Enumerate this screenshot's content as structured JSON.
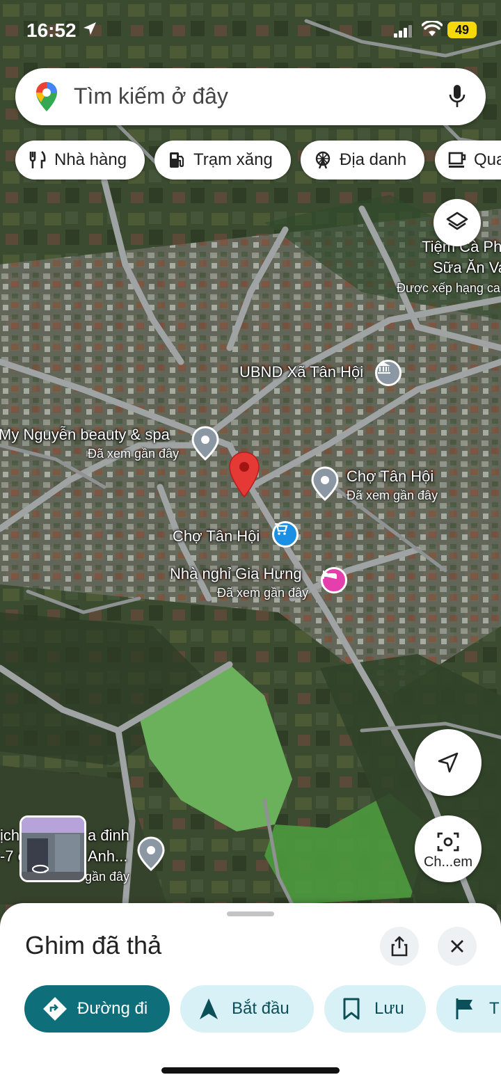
{
  "status": {
    "time": "16:52",
    "battery": "49"
  },
  "search": {
    "placeholder": "Tìm kiếm ở đây"
  },
  "chips": [
    {
      "label": "Nhà hàng",
      "icon": "fork-knife-icon"
    },
    {
      "label": "Trạm xăng",
      "icon": "gas-station-icon"
    },
    {
      "label": "Địa danh",
      "icon": "ferris-wheel-icon"
    },
    {
      "label": "Qua",
      "icon": "coffee-cup-icon"
    }
  ],
  "map_labels": {
    "cafe_line1": "Tiệm Cà Ph",
    "cafe_line2": "Sữa Ăn Va",
    "cafe_line3": "Được xếp hạng ca",
    "ubnd": "UBND Xã Tân Hội",
    "spa": "My Nguyễn beauty & spa",
    "spa_sub": "Đã xem gần đây",
    "cho1": "Chợ Tân Hội",
    "cho1_sub": "Đã xem gần đây",
    "cho2": "Chợ Tân Hội",
    "nha_nghi": "Nhà nghỉ Gia Hưng",
    "nha_nghi_sub": "Đã xem gần đây",
    "bottom_line1": "ịch",
    "bottom_line1b": "a đinh",
    "bottom_line2": "-7 c",
    "bottom_line2b": "Anh...",
    "bottom_sub": "gần đây",
    "lens_label": "Ch...em"
  },
  "sheet": {
    "title": "Ghim đã thả",
    "actions": [
      {
        "label": "Đường đi",
        "icon": "directions-icon"
      },
      {
        "label": "Bắt đầu",
        "icon": "navigation-arrow-icon"
      },
      {
        "label": "Lưu",
        "icon": "bookmark-icon"
      },
      {
        "label": "T",
        "icon": "flag-icon"
      }
    ]
  },
  "colors": {
    "accent": "#0e6f7b",
    "action_bg": "#d8f1f6",
    "pin": "#e53935",
    "poi_gray": "#8b97a2",
    "poi_blue": "#1a8fe3",
    "poi_pink": "#e53fae"
  }
}
